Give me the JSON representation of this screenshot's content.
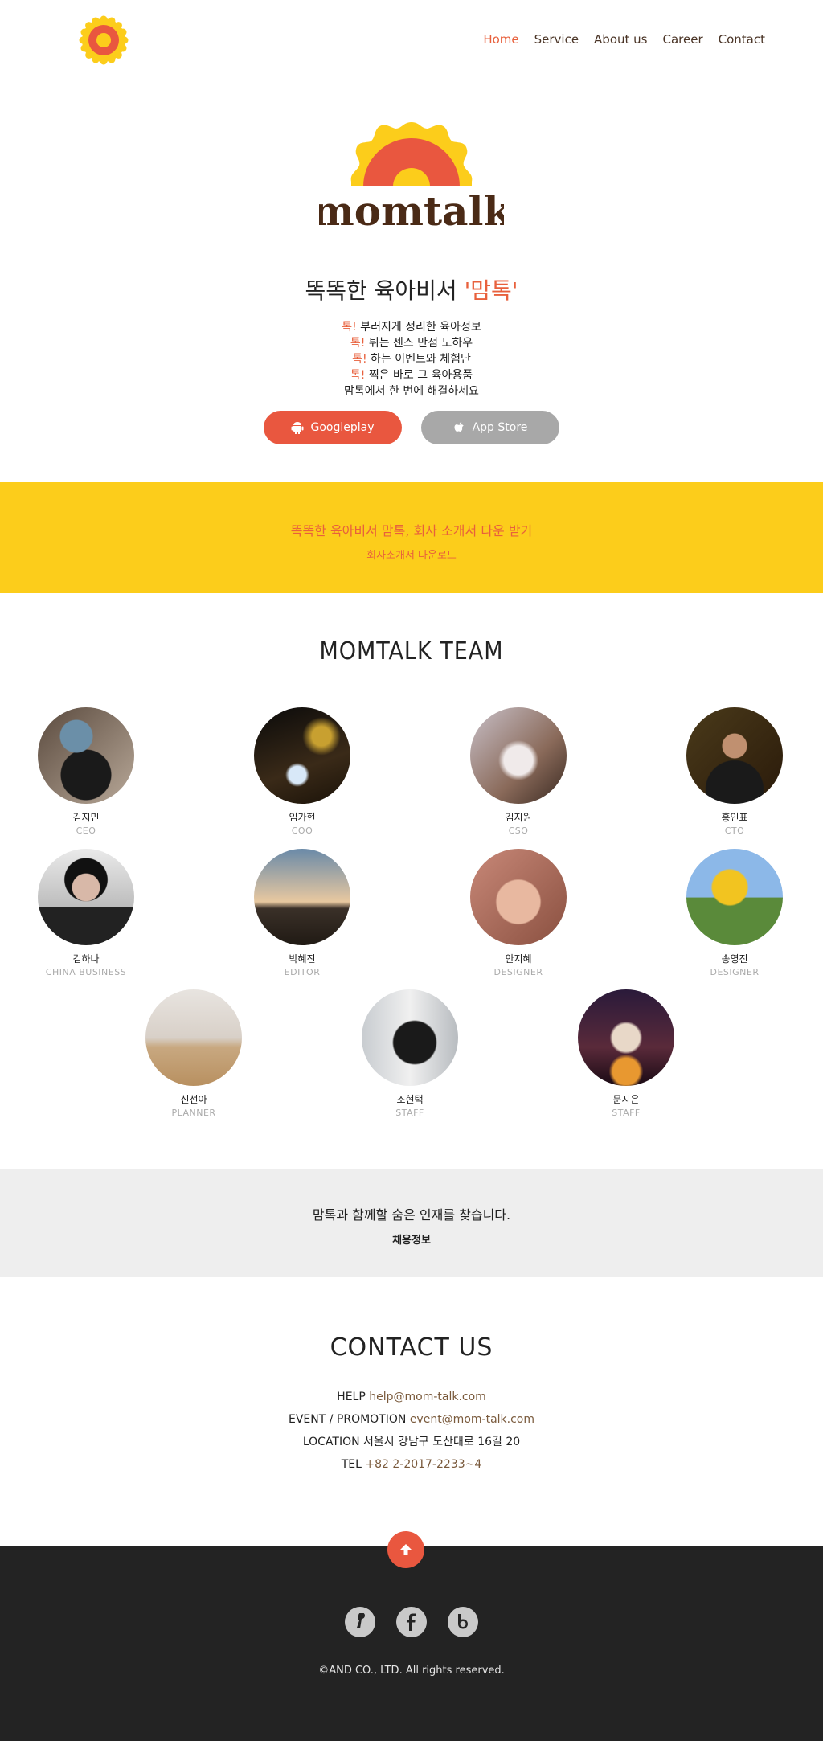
{
  "nav": {
    "items": [
      "Home",
      "Service",
      "About us",
      "Career",
      "Contact"
    ],
    "active": "Home"
  },
  "hero": {
    "brand_wordmark": "momtalk",
    "tagline_prefix": "똑똑한 육아비서 ",
    "tagline_brand": "'맘톡'",
    "features": [
      {
        "hl": "톡!",
        "text": " 부러지게 정리한 육아정보"
      },
      {
        "hl": "톡!",
        "text": " 튀는 센스 만점 노하우"
      },
      {
        "hl": "톡!",
        "text": " 하는 이벤트와 체험단"
      },
      {
        "hl": "톡!",
        "text": " 찍은 바로 그 육아용품"
      },
      {
        "hl": "",
        "text": "맘톡에서 한 번에 해결하세요"
      }
    ],
    "googleplay_label": "Googleplay",
    "appstore_label": "App Store"
  },
  "band": {
    "title": "똑똑한 육아비서 맘톡, 회사 소개서 다운 받기",
    "link": "회사소개서 다운로드"
  },
  "team": {
    "heading": "MOMTALK TEAM",
    "members": [
      {
        "name": "김지민",
        "role": "CEO"
      },
      {
        "name": "임가현",
        "role": "COO"
      },
      {
        "name": "김지원",
        "role": "CSO"
      },
      {
        "name": "홍인표",
        "role": "CTO"
      },
      {
        "name": "김하나",
        "role": "CHINA BUSINESS"
      },
      {
        "name": "박혜진",
        "role": "EDITOR"
      },
      {
        "name": "안지혜",
        "role": "DESIGNER"
      },
      {
        "name": "송영진",
        "role": "DESIGNER"
      },
      {
        "name": "신선아",
        "role": "PLANNER"
      },
      {
        "name": "조현택",
        "role": "STAFF"
      },
      {
        "name": "문시은",
        "role": "STAFF"
      }
    ]
  },
  "career": {
    "title": "맘톡과 함께할 숨은 인재를 찾습니다.",
    "link": "채용정보"
  },
  "contact": {
    "heading": "CONTACT US",
    "help_label": "HELP",
    "help_value": "help@mom-talk.com",
    "event_label": "EVENT / PROMOTION",
    "event_value": "event@mom-talk.com",
    "location_label": "LOCATION",
    "location_value": "서울시 강남구 도산대로 16길 20",
    "tel_label": "TEL",
    "tel_value": "+82 2-2017-2233~4"
  },
  "footer": {
    "copyright": "©AND CO., LTD. All rights reserved.",
    "social_icons": [
      "kakao-story-icon",
      "facebook-icon",
      "blog-icon"
    ]
  },
  "colors": {
    "accent": "#e8603c",
    "yellow": "#fccd1b",
    "brown": "#4a3426",
    "footer_bg": "#232323"
  }
}
